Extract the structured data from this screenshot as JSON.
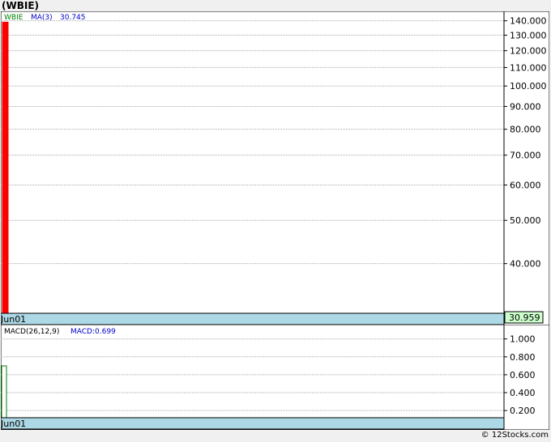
{
  "title": "(WBIE)",
  "copyright": "© 12Stocks.com",
  "colors": {
    "grid": "#aaaaaa",
    "frame": "#000000",
    "date_strip": "#add8e6",
    "price_bar": "#ff0000",
    "macd_bar": "#008000",
    "last_price_box": "#ccffcc",
    "ticker_legend": "#008000",
    "ma_legend": "#0000cc",
    "macd_legend_value": "#0000cc"
  },
  "price_legend": {
    "ticker": "WBIE",
    "ma_label": "MA(3)",
    "ma_value": "30.745"
  },
  "price_date_label": "Jun01",
  "last_price": "30.959",
  "macd_legend": {
    "label": "MACD(26,12,9)",
    "value_label": "MACD:0.699"
  },
  "macd_date_label": "Jun01",
  "chart_data": [
    {
      "type": "bar",
      "name": "price",
      "scale": "log",
      "x": [
        "Jun01"
      ],
      "values": [
        139
      ],
      "ylim": [
        30.959,
        147
      ],
      "ticks": [
        {
          "value": 40,
          "label": "40.000"
        },
        {
          "value": 50,
          "label": "50.000"
        },
        {
          "value": 60,
          "label": "60.000"
        },
        {
          "value": 70,
          "label": "70.000"
        },
        {
          "value": 80,
          "label": "80.000"
        },
        {
          "value": 90,
          "label": "90.000"
        },
        {
          "value": 100,
          "label": "100.000"
        },
        {
          "value": 110,
          "label": "110.000"
        },
        {
          "value": 120,
          "label": "120.000"
        },
        {
          "value": 130,
          "label": "130.000"
        },
        {
          "value": 140,
          "label": "140.000"
        }
      ],
      "ma_3": 30.745,
      "grid": true
    },
    {
      "type": "bar",
      "name": "macd",
      "scale": "linear",
      "x": [
        "Jun01"
      ],
      "values": [
        0.699
      ],
      "ylim": [
        0.12,
        1.16
      ],
      "ticks": [
        {
          "value": 0.2,
          "label": "0.200"
        },
        {
          "value": 0.4,
          "label": "0.400"
        },
        {
          "value": 0.6,
          "label": "0.600"
        },
        {
          "value": 0.8,
          "label": "0.800"
        },
        {
          "value": 1.0,
          "label": "1.000"
        }
      ],
      "grid": true
    }
  ]
}
